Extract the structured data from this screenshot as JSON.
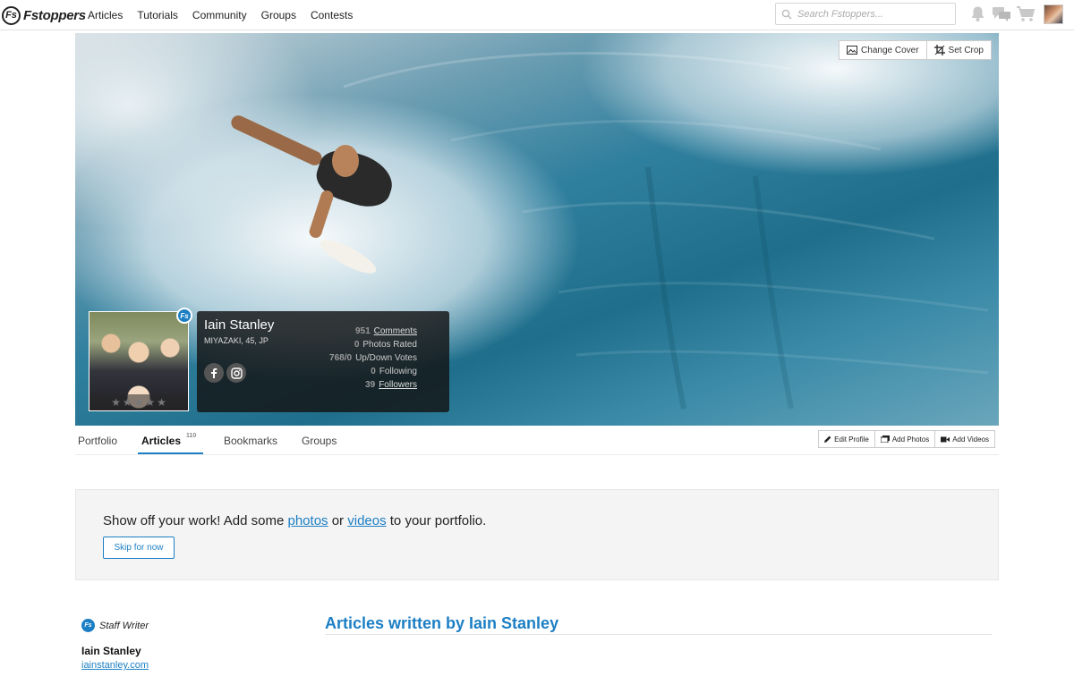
{
  "brand": {
    "logo_badge": "Fs",
    "name": "Fstoppers"
  },
  "nav": {
    "items": [
      "Articles",
      "Tutorials",
      "Community",
      "Groups",
      "Contests"
    ]
  },
  "search": {
    "placeholder": "Search Fstoppers..."
  },
  "icons": {
    "notifications": "bell-icon",
    "messages": "chat-icon",
    "cart": "cart-icon",
    "user": "user-avatar"
  },
  "cover": {
    "change_cover_label": "Change Cover",
    "set_crop_label": "Set Crop"
  },
  "profile": {
    "name": "Iain Stanley",
    "location": "MIYAZAKI, 45, JP",
    "badge": "Fs",
    "rating_stars": 5,
    "social": [
      "facebook",
      "instagram"
    ],
    "stats": [
      {
        "value": "951",
        "label": "Comments",
        "link": true
      },
      {
        "value": "0",
        "label": "Photos Rated",
        "link": false
      },
      {
        "value": "768/0",
        "label": "Up/Down Votes",
        "link": false
      },
      {
        "value": "0",
        "label": "Following",
        "link": false
      },
      {
        "value": "39",
        "label": "Followers",
        "link": true
      }
    ]
  },
  "tabs": {
    "portfolio": "Portfolio",
    "articles": "Articles",
    "articles_count": "110",
    "bookmarks": "Bookmarks",
    "groups": "Groups",
    "edit_profile": "Edit Profile",
    "add_photos": "Add Photos",
    "add_videos": "Add Videos"
  },
  "prompt": {
    "text_1": "Show off your work! Add some ",
    "photos_link": "photos",
    "text_2": " or ",
    "videos_link": "videos",
    "text_3": " to your portfolio.",
    "skip_label": "Skip for now"
  },
  "author": {
    "badge": "Fs",
    "role": "Staff Writer",
    "name": "Iain Stanley",
    "website": "iainstanley.com"
  },
  "articles_heading": "Articles written by Iain Stanley",
  "colors": {
    "accent": "#1c7fc4",
    "card_bg": "#141414",
    "prompt_bg": "#f4f4f4"
  }
}
